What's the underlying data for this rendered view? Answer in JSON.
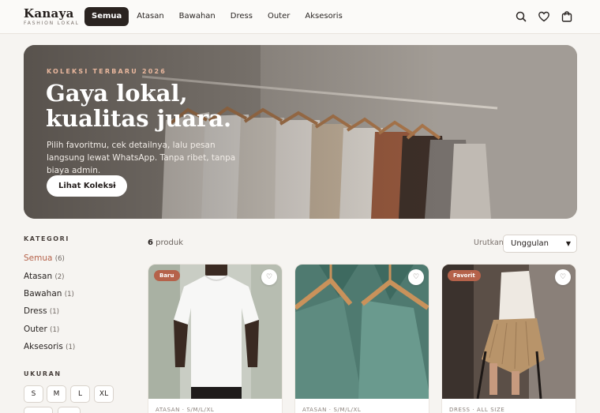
{
  "brand": {
    "name": "Kanaya",
    "tagline": "FASHION LOKAL"
  },
  "nav": [
    "Semua",
    "Atasan",
    "Bawahan",
    "Dress",
    "Outer",
    "Aksesoris"
  ],
  "header_icons": [
    "search-icon",
    "heart-icon",
    "bag-icon"
  ],
  "hero": {
    "eyebrow": "KOLEKSI TERBARU 2026",
    "title_line1": "Gaya lokal,",
    "title_line2": "kualitas juara.",
    "subtitle": "Pilih favoritmu, cek detailnya, lalu pesan langsung lewat WhatsApp. Tanpa ribet, tanpa biaya admin.",
    "cta": "Lihat Koleksi",
    "cta_icon": "→"
  },
  "sidebar": {
    "category_heading": "KATEGORI",
    "categories": [
      {
        "label": "Semua",
        "count": "(6)"
      },
      {
        "label": "Atasan",
        "count": "(2)"
      },
      {
        "label": "Bawahan",
        "count": "(1)"
      },
      {
        "label": "Dress",
        "count": "(1)"
      },
      {
        "label": "Outer",
        "count": "(1)"
      },
      {
        "label": "Aksesoris",
        "count": "(1)"
      }
    ],
    "size_heading": "UKURAN",
    "sizes": [
      "S",
      "M",
      "L",
      "XL"
    ]
  },
  "toolbar": {
    "count_number": "6",
    "count_label": "produk",
    "sort_label": "Urutkan",
    "sort_value": "Unggulan"
  },
  "products": [
    {
      "badge": "Baru",
      "meta": "ATASAN · S/M/L/XL"
    },
    {
      "badge": "",
      "meta": "ATASAN · S/M/L/XL"
    },
    {
      "badge": "Favorit",
      "meta": "DRESS · ALL SIZE"
    }
  ],
  "colors": {
    "accent": "#b5624a",
    "dark": "#2a2320",
    "background": "#f6f4f1"
  }
}
